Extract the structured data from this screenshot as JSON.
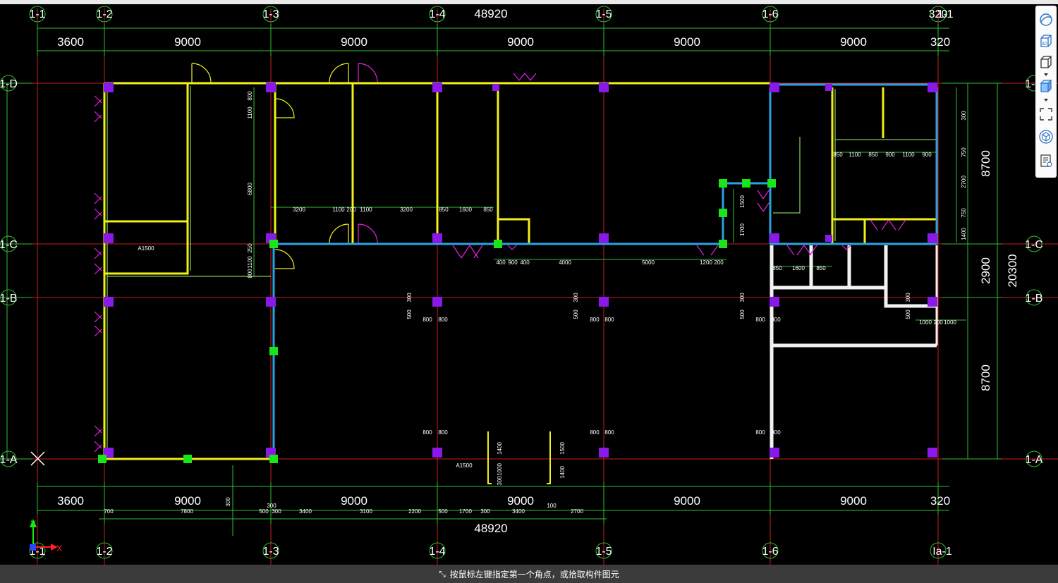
{
  "colors": {
    "background": "#000000",
    "grid_axis": "#c81e1e",
    "dimension": "#2fbf2f",
    "wall_yellow": "#f3ef1a",
    "wall_blue": "#2aa3e0",
    "wall_white": "#f2f2f2",
    "column": "#8a18e8",
    "node": "#19e619",
    "door": "#e81ee8",
    "status_bar": "#3b3b3b"
  },
  "axes_top": [
    "1-1",
    "1-2",
    "1-3",
    "1-4",
    "1-5",
    "1-6",
    "320"
  ],
  "axes_top_right_overlap": "1-1",
  "axes_bottom": [
    "1-1",
    "1-2",
    "1-3",
    "1-4",
    "1-5",
    "1-6",
    "Ia-1"
  ],
  "axes_right": [
    "1-D",
    "1-C",
    "1-B",
    "1-A"
  ],
  "axes_left": [
    "1-D",
    "1-C",
    "1-B",
    "1-A"
  ],
  "total_width_label": "48920",
  "top_spans": [
    "3600",
    "9000",
    "9000",
    "9000",
    "9000",
    "9000",
    "320"
  ],
  "bottom_spans": [
    "3600",
    "9000",
    "9000",
    "9000",
    "9000",
    "9000",
    "320"
  ],
  "bottom_total_label": "48920",
  "right_spans": [
    "8700",
    "2900",
    "8700"
  ],
  "right_total": "20300",
  "bottom_detail_dims": [
    "700",
    "7800",
    "300",
    "500",
    "300",
    "3400",
    "3100",
    "2200",
    "500",
    "1700",
    "300",
    "3400",
    "100",
    "2700"
  ],
  "upper_detail_dims": [
    "3200",
    "1100",
    "200",
    "1100",
    "3200",
    "850",
    "1600",
    "850"
  ],
  "mid_detail_dims": [
    "400",
    "900",
    "400",
    "4000",
    "5000",
    "1200",
    "200"
  ],
  "right_room_dims": [
    "850",
    "1100",
    "850",
    "900",
    "1100",
    "900"
  ],
  "right_room_vdims": [
    "300",
    "750",
    "2700",
    "750",
    "1400"
  ],
  "right_lower_dims": [
    "850",
    "1600",
    "850"
  ],
  "pair_dims": [
    "800",
    "800"
  ],
  "right_pair_dims": [
    "1000",
    "200",
    "1000"
  ],
  "tag_label": "A1500",
  "vertical_dims_left": [
    "800",
    "1100",
    "6800",
    "250",
    "1100",
    "800"
  ],
  "vertical_dims_mid": [
    "1500",
    "1700"
  ],
  "door_small_dims": [
    "300",
    "500"
  ],
  "window_dims": [
    "1400",
    "1000",
    "300",
    "1500",
    "1400"
  ],
  "ucs": {
    "y_label": "Y",
    "x_label": "X"
  },
  "toolbar": {
    "items": [
      {
        "name": "orbit",
        "icon": "orbit-icon"
      },
      {
        "name": "3d",
        "icon": "3d-view-icon",
        "label": "3D"
      },
      {
        "name": "view-cube",
        "icon": "view-cube-icon"
      },
      {
        "name": "shaded",
        "icon": "shaded-cube-icon"
      },
      {
        "name": "zoom-extents",
        "icon": "zoom-extents-icon"
      },
      {
        "name": "isolate",
        "icon": "isolate-cube-icon"
      },
      {
        "name": "properties",
        "icon": "properties-list-icon"
      }
    ]
  },
  "status": {
    "text": "按鼠标左键指定第一个角点，或拾取构件图元"
  }
}
